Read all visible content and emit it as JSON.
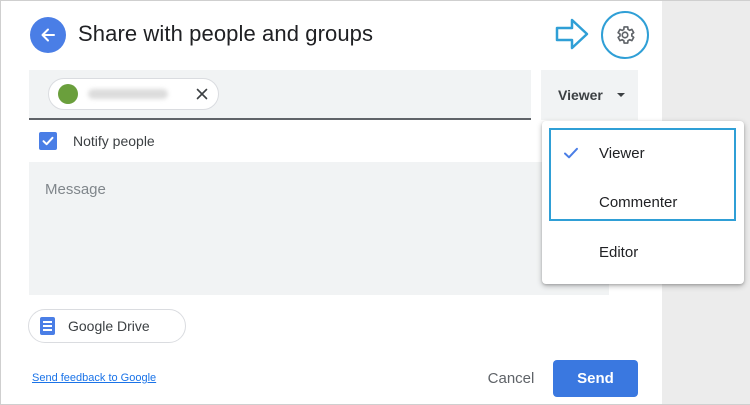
{
  "dialog": {
    "title": "Share with people and groups"
  },
  "people_input": {
    "chip_close_icon": "close-icon"
  },
  "role_dropdown": {
    "selected": "Viewer"
  },
  "role_menu": {
    "items": [
      {
        "label": "Viewer",
        "checked": true
      },
      {
        "label": "Commenter",
        "checked": false
      },
      {
        "label": "Editor",
        "checked": false
      }
    ]
  },
  "notify": {
    "label": "Notify people",
    "checked": true
  },
  "message": {
    "placeholder": "Message"
  },
  "drive_button": {
    "label": "Google Drive"
  },
  "footer": {
    "feedback_link": "Send feedback to Google",
    "cancel": "Cancel",
    "send": "Send"
  },
  "colors": {
    "accent": "#4a7ee6",
    "highlight": "#2f9fd6",
    "field_bg": "#f1f3f4"
  }
}
